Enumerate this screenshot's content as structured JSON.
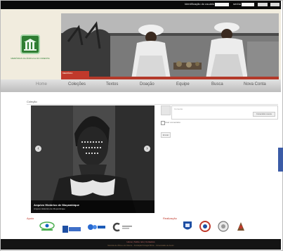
{
  "topbar": {
    "login_label": "Identificação do usuário",
    "password_label": "senha"
  },
  "header": {
    "logo_text": "MEMÓRIAS DA ÁFRICA E DO ORIENTE",
    "photo_caption": "MEMÓRIA"
  },
  "nav": {
    "items": [
      "Home",
      "Coleções",
      "Textos",
      "Doação",
      "Equipe",
      "Busca",
      "Nova Conta"
    ]
  },
  "content": {
    "breadcrumb": "Coleção",
    "slider": {
      "title": "Arquivo Histórico de Moçambique",
      "subtitle": "Arquivo Histórico de Moçambique"
    },
    "comment": {
      "placeholder": "Comente",
      "button_label": "Comentário recente"
    },
    "checkbox_label": "Usar comentário",
    "small_button_label": "Enviar"
  },
  "partners": {
    "left_label": "Apoio",
    "right_label": "Realização"
  },
  "footer": {
    "line1": "Home | Sobre nós | Contactos",
    "line2": "Memória de África e do Oriente – Fundação Portugal-África – Universidade de Aveiro"
  },
  "colors": {
    "topbar_bg": "#0a0a0a",
    "header_bg": "#f1ecde",
    "logo_green": "#2e7d32",
    "accent_red": "#c0392b",
    "facebook_blue": "#3b5ba6"
  }
}
